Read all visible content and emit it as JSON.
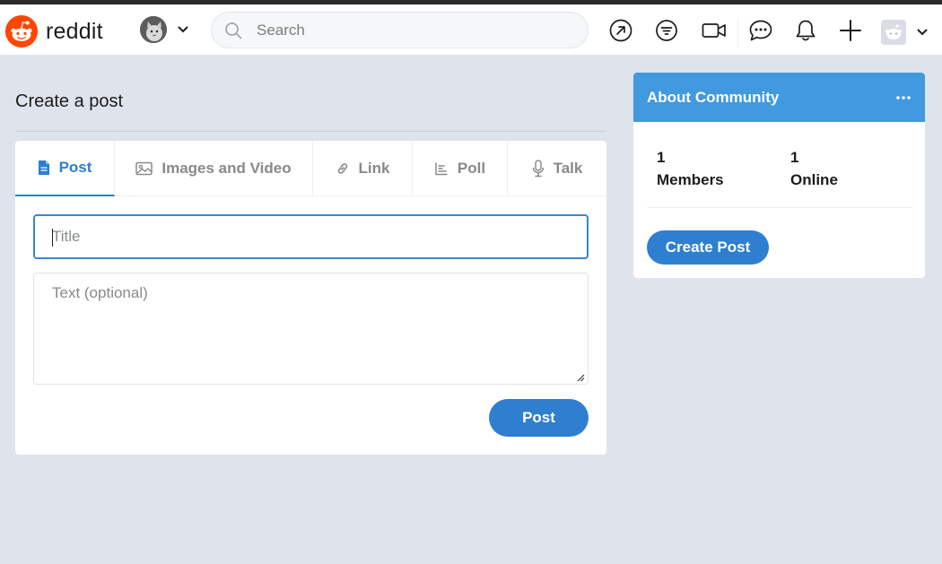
{
  "header": {
    "brand": "reddit",
    "search_placeholder": "Search",
    "icons": [
      "popular-icon",
      "feed-filter-icon",
      "video-icon",
      "chat-icon",
      "notification-icon",
      "plus-icon"
    ]
  },
  "page": {
    "title": "Create a post"
  },
  "tabs": [
    {
      "label": "Post",
      "icon": "document-icon",
      "active": true
    },
    {
      "label": "Images and Video",
      "icon": "image-icon"
    },
    {
      "label": "Link",
      "icon": "link-icon"
    },
    {
      "label": "Poll",
      "icon": "poll-icon"
    },
    {
      "label": "Talk",
      "icon": "microphone-icon"
    }
  ],
  "form": {
    "title_placeholder": "Title",
    "title_value": "",
    "text_placeholder": "Text (optional)",
    "text_value": "",
    "submit_label": "Post"
  },
  "about": {
    "title": "About Community",
    "members_count": "1",
    "members_label": "Members",
    "online_count": "1",
    "online_label": "Online",
    "create_label": "Create Post"
  },
  "colors": {
    "accent": "#2e7fcf",
    "about_header": "#4199e0",
    "brand_orange": "#ff4500",
    "background": "#dfe4ec"
  }
}
